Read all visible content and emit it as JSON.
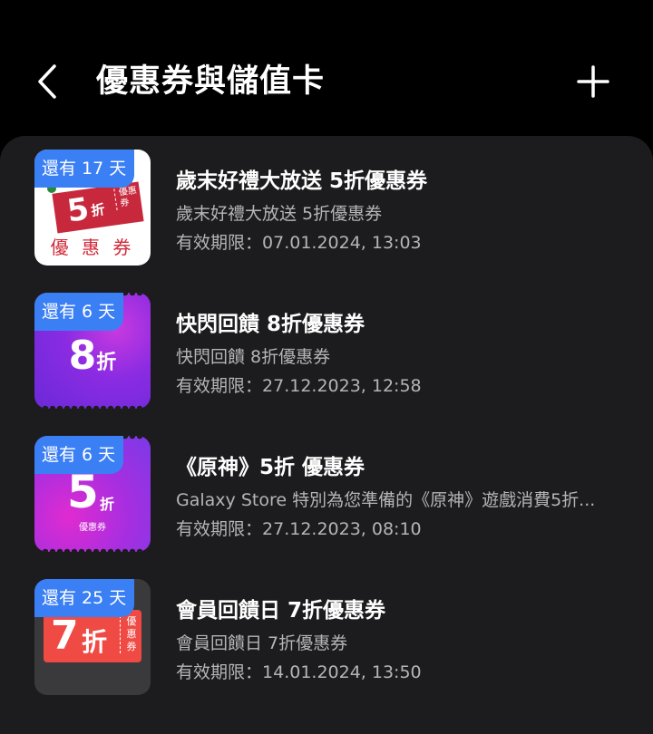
{
  "header": {
    "title": "優惠券與儲值卡",
    "back_icon": "chevron-left-icon",
    "add_icon": "plus-icon"
  },
  "colors": {
    "background": "#000000",
    "panel": "#1c1c1e",
    "badge": "#3b7ff5",
    "secondary_text": "#b5b5b8"
  },
  "coupons": [
    {
      "badge": "還有 17 天",
      "title": "歲末好禮大放送 5折優惠券",
      "description": "歲末好禮大放送 5折優惠券",
      "expiry_label": "有效期限：",
      "expiry": "07.01.2024, 13:03",
      "thumb": {
        "number": "5",
        "unit": "折",
        "side_text": "優惠券",
        "caption": "優 惠 券"
      }
    },
    {
      "badge": "還有 6 天",
      "title": "快閃回饋 8折優惠券",
      "description": "快閃回饋 8折優惠券",
      "expiry_label": "有效期限：",
      "expiry": "27.12.2023, 12:58",
      "thumb": {
        "number": "8",
        "unit": "折"
      }
    },
    {
      "badge": "還有 6 天",
      "title": "《原神》5折 優惠券",
      "description": "Galaxy Store 特別為您準備的《原神》遊戲消費5折...",
      "expiry_label": "有效期限：",
      "expiry": "27.12.2023, 08:10",
      "thumb": {
        "number": "5",
        "unit": "折",
        "caption": "優惠券"
      }
    },
    {
      "badge": "還有 25 天",
      "title": "會員回饋日 7折優惠券",
      "description": "會員回饋日 7折優惠券",
      "expiry_label": "有效期限：",
      "expiry": "14.01.2024, 13:50",
      "thumb": {
        "number": "7",
        "unit": "折",
        "side_text": "優惠券"
      }
    }
  ]
}
